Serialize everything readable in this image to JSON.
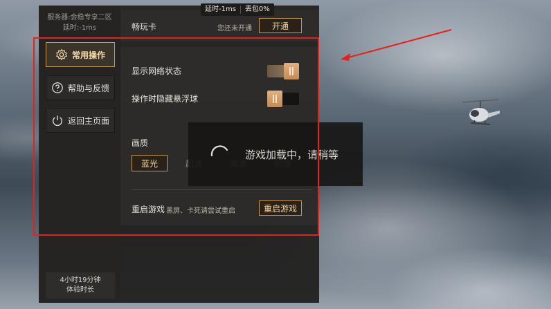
{
  "status_bar": {
    "latency": "延时-1ms",
    "packet_loss": "丢包0%"
  },
  "sidebar": {
    "server_line": "服务器:会稳专享二区",
    "latency_line": "延时:-1ms",
    "items": [
      {
        "label": "常用操作",
        "icon": "gear-icon",
        "active": true
      },
      {
        "label": "帮助与反馈",
        "icon": "question-icon",
        "active": false
      },
      {
        "label": "返回主页面",
        "icon": "power-icon",
        "active": false
      }
    ],
    "trial": {
      "time": "4小时19分钟",
      "label": "体验时长"
    }
  },
  "card": {
    "title": "畅玩卡",
    "status": "您还未开通",
    "button": "开通"
  },
  "settings": {
    "network_label": "显示网络状态",
    "network_on": true,
    "hide_ball_label": "操作时隐藏悬浮球",
    "hide_ball_on": false,
    "quality_label": "画质",
    "quality_options": [
      "蓝光",
      "超清",
      "高清",
      "标清"
    ],
    "quality_selected": "蓝光",
    "restart_label": "重启游戏",
    "restart_hint": "黑屏、卡死请尝试重启",
    "restart_button": "重启游戏"
  },
  "loading": {
    "text": "游戏加载中，请稍等"
  },
  "colors": {
    "accent": "#c89a55",
    "annotation": "#e3221c",
    "panel": "#222120"
  }
}
